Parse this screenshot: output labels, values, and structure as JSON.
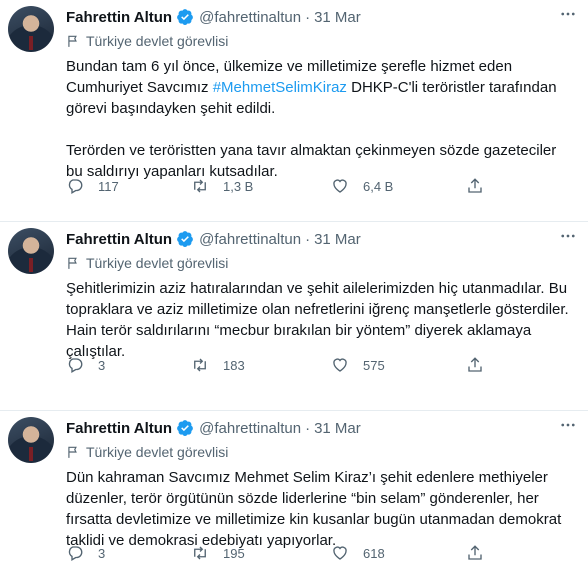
{
  "tweets": [
    {
      "author": "Fahrettin Altun",
      "handle": "@fahrettinaltun",
      "separator": "·",
      "date": "31 Mar",
      "label": "Türkiye devlet görevlisi",
      "paragraphs": [
        {
          "before": "Bundan tam 6 yıl önce, ülkemize ve milletimize şerefle hizmet eden Cumhuriyet Savcımız ",
          "hashtag": "#MehmetSelimKiraz",
          "after": " DHKP-C'li teröristler tarafından görevi başındayken şehit edildi."
        },
        {
          "before": "Terörden ve teröristten yana tavır almaktan çekinmeyen sözde gazeteciler bu saldırıyı yapanları kutsadılar.",
          "hashtag": "",
          "after": ""
        }
      ],
      "replies": "117",
      "retweets": "1,3 B",
      "likes": "6,4 B"
    },
    {
      "author": "Fahrettin Altun",
      "handle": "@fahrettinaltun",
      "separator": "·",
      "date": "31 Mar",
      "label": "Türkiye devlet görevlisi",
      "paragraphs": [
        {
          "before": "Şehitlerimizin aziz hatıralarından ve şehit ailelerimizden hiç utanmadılar. Bu topraklara ve aziz milletimize olan nefretlerini iğrenç manşetlerle gösterdiler. Hain terör saldırılarını “mecbur bırakılan bir yöntem” diyerek aklamaya çalıştılar.",
          "hashtag": "",
          "after": ""
        }
      ],
      "replies": "3",
      "retweets": "183",
      "likes": "575"
    },
    {
      "author": "Fahrettin Altun",
      "handle": "@fahrettinaltun",
      "separator": "·",
      "date": "31 Mar",
      "label": "Türkiye devlet görevlisi",
      "paragraphs": [
        {
          "before": "Dün kahraman Savcımız Mehmet Selim Kiraz’ı şehit edenlere methiyeler düzenler, terör örgütünün sözde liderlerine “bin selam” gönderenler, her fırsatta devletimize ve milletimize kin kusanlar bugün utanmadan demokrat taklidi ve demokrasi edebiyatı yapıyorlar.",
          "hashtag": "",
          "after": ""
        }
      ],
      "replies": "3",
      "retweets": "195",
      "likes": "618"
    }
  ],
  "colors": {
    "text": "#0f1419",
    "secondary": "#536471",
    "link": "#1d9bf0",
    "verified": "#1d9bf0",
    "divider": "#e6ecf0"
  },
  "icons": {
    "verified": "verified-badge-icon",
    "label": "flag-icon",
    "more": "more-dots-icon",
    "reply": "reply-icon",
    "retweet": "retweet-icon",
    "like": "heart-icon",
    "share": "share-icon"
  }
}
